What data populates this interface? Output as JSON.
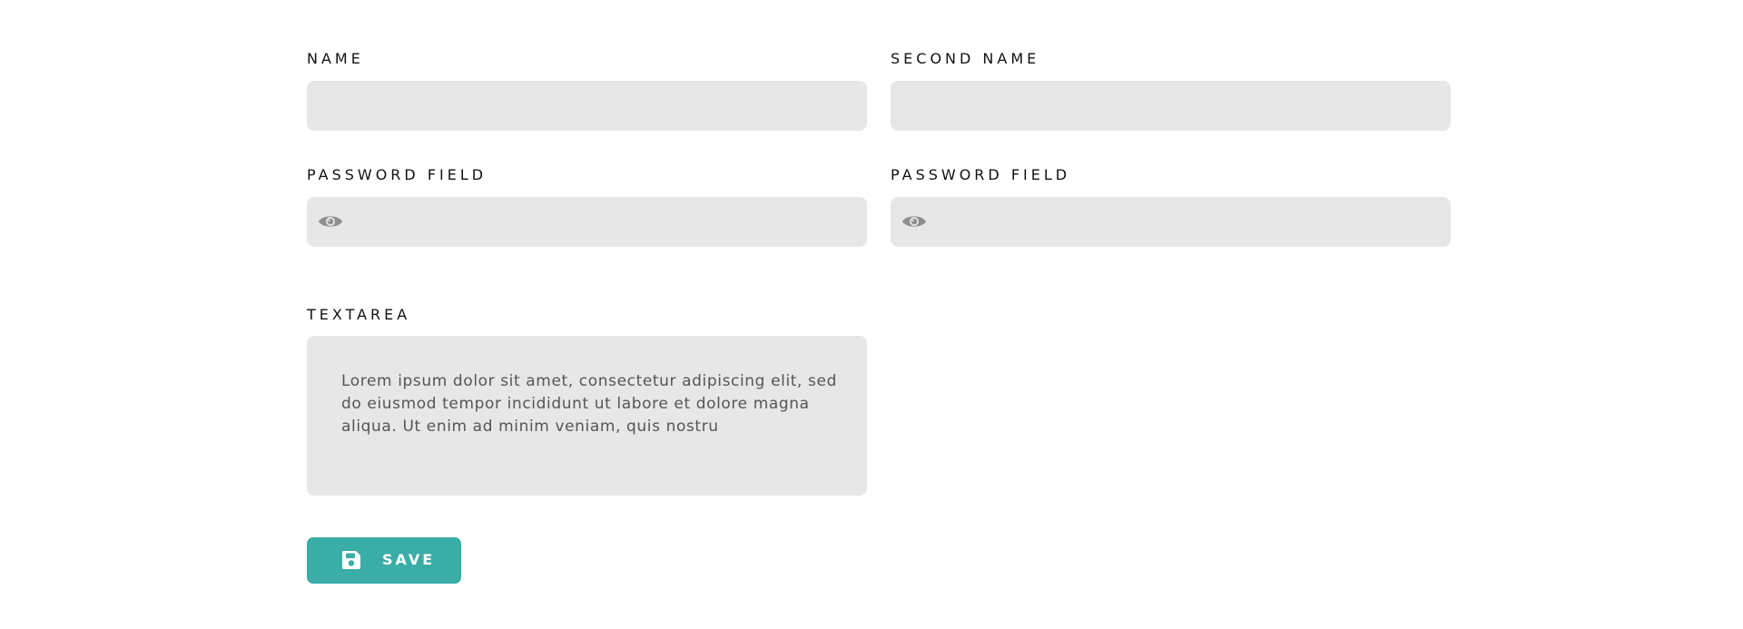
{
  "form": {
    "name": {
      "label": "NAME",
      "value": "",
      "placeholder": ""
    },
    "second_name": {
      "label": "SECOND NAME",
      "value": "",
      "placeholder": ""
    },
    "password_1": {
      "label": "PASSWORD FIELD",
      "value": "",
      "icon": "eye-icon"
    },
    "password_2": {
      "label": "PASSWORD FIELD",
      "value": "",
      "icon": "eye-icon"
    },
    "textarea": {
      "label": "TEXTAREA",
      "value": "Lorem ipsum dolor sit amet, consectetur adipiscing elit, sed do eiusmod tempor incididunt ut labore et dolore magna aliqua. Ut enim ad minim veniam, quis nostru"
    },
    "save_button": {
      "label": "SAVE",
      "icon": "floppy-disk-icon"
    }
  },
  "colors": {
    "input_background": "#e7e7e7",
    "accent": "#39ada6",
    "icon_gray": "#8e8e8e"
  }
}
